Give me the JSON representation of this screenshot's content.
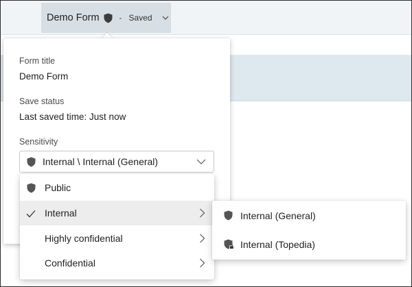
{
  "header": {
    "form_name": "Demo Form",
    "separator": "-",
    "save_state": "Saved"
  },
  "panel": {
    "form_title_label": "Form title",
    "form_title_value": "Demo Form",
    "save_status_label": "Save status",
    "save_status_value": "Last saved time: Just now",
    "sensitivity_label": "Sensitivity",
    "sensitivity_selected": "Internal \\ Internal (General)"
  },
  "menu": {
    "items": [
      {
        "label": "Public",
        "icon": "shield-icon",
        "selected": false,
        "has_submenu": false
      },
      {
        "label": "Internal",
        "icon": "checkmark-icon",
        "selected": true,
        "has_submenu": true
      },
      {
        "label": "Highly confidential",
        "icon": "",
        "selected": false,
        "has_submenu": true
      },
      {
        "label": "Confidential",
        "icon": "",
        "selected": false,
        "has_submenu": true
      }
    ]
  },
  "submenu": {
    "items": [
      {
        "label": "Internal (General)",
        "icon": "shield-icon"
      },
      {
        "label": "Internal (Topedia)",
        "icon": "shield-lock-icon"
      }
    ]
  },
  "colors": {
    "shield": "#555555",
    "hover_bg": "#ededed",
    "banner": "#dde9ee"
  }
}
